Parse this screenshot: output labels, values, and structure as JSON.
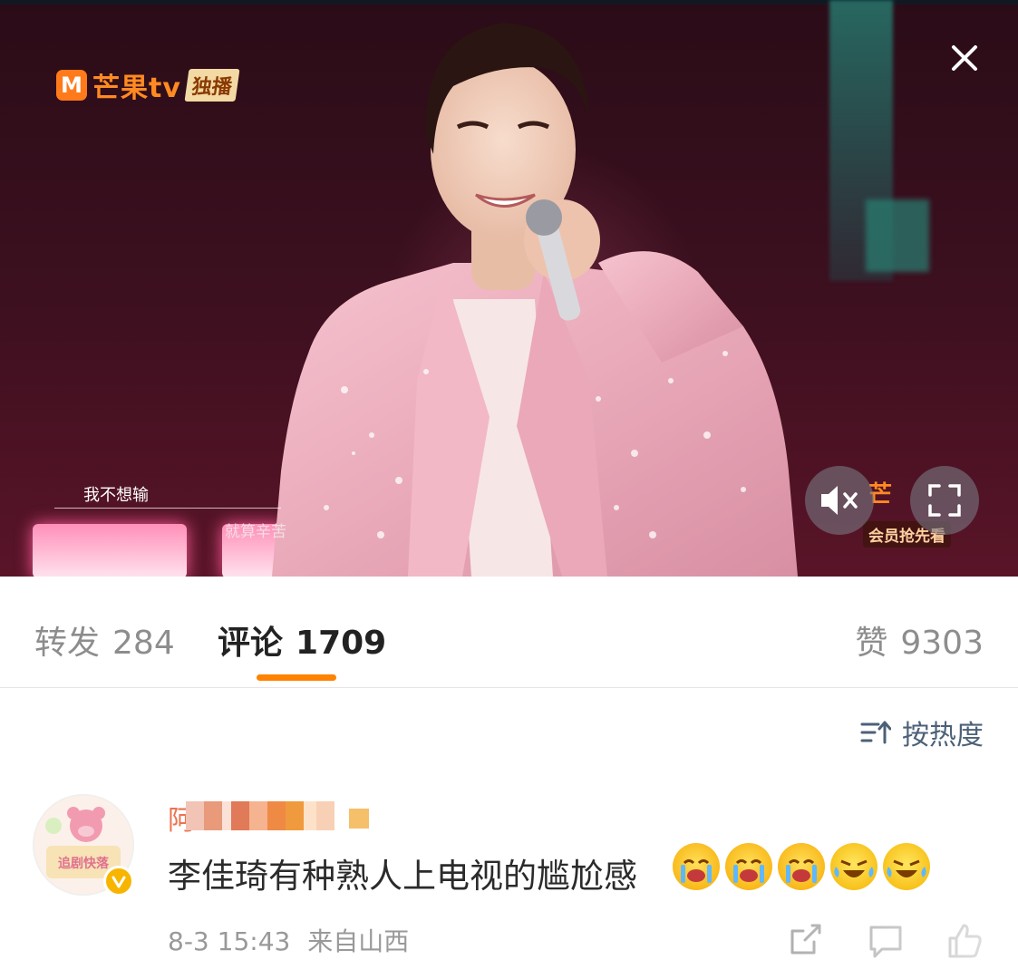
{
  "video": {
    "logo_mark": "M",
    "logo_text": "芒果tv",
    "logo_badge": "独播",
    "lyric_1": "我不想输",
    "lyric_2": "就算辛苦",
    "watermark_text": "芒",
    "watermark_sub": "会员抢先看",
    "close_icon": "close-icon",
    "mute_icon": "mute-icon",
    "fullscreen_icon": "fullscreen-icon"
  },
  "tabs": {
    "repost_label": "转发",
    "repost_count": "284",
    "comment_label": "评论",
    "comment_count": "1709",
    "like_label": "赞",
    "like_count": "9303",
    "active_color": "#ff8200"
  },
  "sort": {
    "label": "按热度",
    "icon": "sort-icon"
  },
  "comment": {
    "username": "阿",
    "text": "李佳琦有种熟人上电视的尴尬感",
    "emojis": [
      "crying-emoji",
      "crying-emoji",
      "crying-emoji",
      "laughing-tears-emoji",
      "laughing-tears-emoji"
    ],
    "date": "8-3",
    "time": "15:43",
    "location": "来自山西",
    "avatar_text": "追剧快落",
    "verified_color": "#f7b500",
    "actions": [
      "share-icon",
      "comment-icon",
      "like-icon"
    ]
  }
}
